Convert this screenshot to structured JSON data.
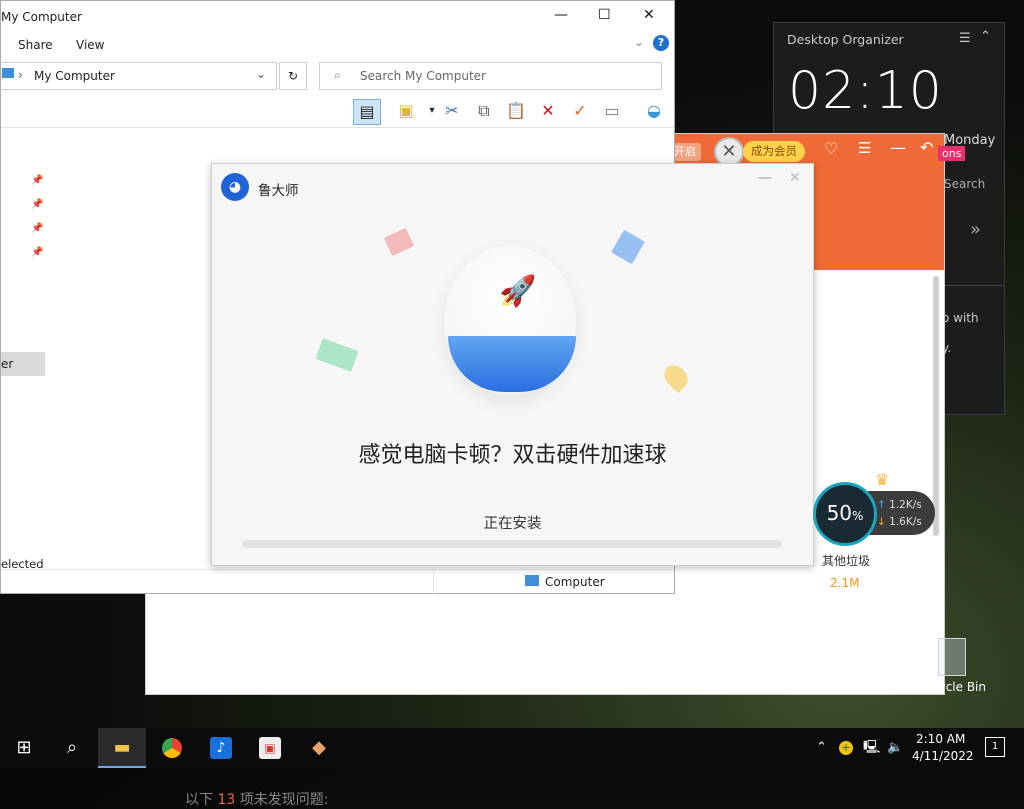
{
  "organizer": {
    "title": "Desktop Organizer",
    "time": "02:10",
    "day_partial": "Monday",
    "search_partial": "Search",
    "hint_line1": "o with",
    "hint_line2": "y."
  },
  "orange_app": {
    "open_partial": "开启",
    "vip_label": "成为会员",
    "badge_partial": "ons",
    "other_junk_label": "其他垃圾",
    "other_junk_size": "2.1M",
    "issues_prefix": "以下",
    "issues_count": "13",
    "issues_suffix": "项未发现问题:"
  },
  "speed_ball": {
    "percent": "50",
    "percent_sign": "%",
    "upload": "1.2K/s",
    "download": "1.6K/s"
  },
  "explorer": {
    "title": "My Computer",
    "ribbon": [
      "Share",
      "View"
    ],
    "address": "My Computer",
    "search_placeholder": "Search My Computer",
    "nav_selected_partial": "er",
    "status_selected_partial": "elected",
    "status_computer": "Computer"
  },
  "installer": {
    "app_name": "鲁大师",
    "headline": "感觉电脑卡顿？双击硬件加速球",
    "status": "正在安装",
    "progress": 0
  },
  "desktop": {
    "recycle_bin_partial": "cycle Bin"
  },
  "taskbar": {
    "time": "2:10 AM",
    "date": "4/11/2022",
    "notifications": "1"
  }
}
